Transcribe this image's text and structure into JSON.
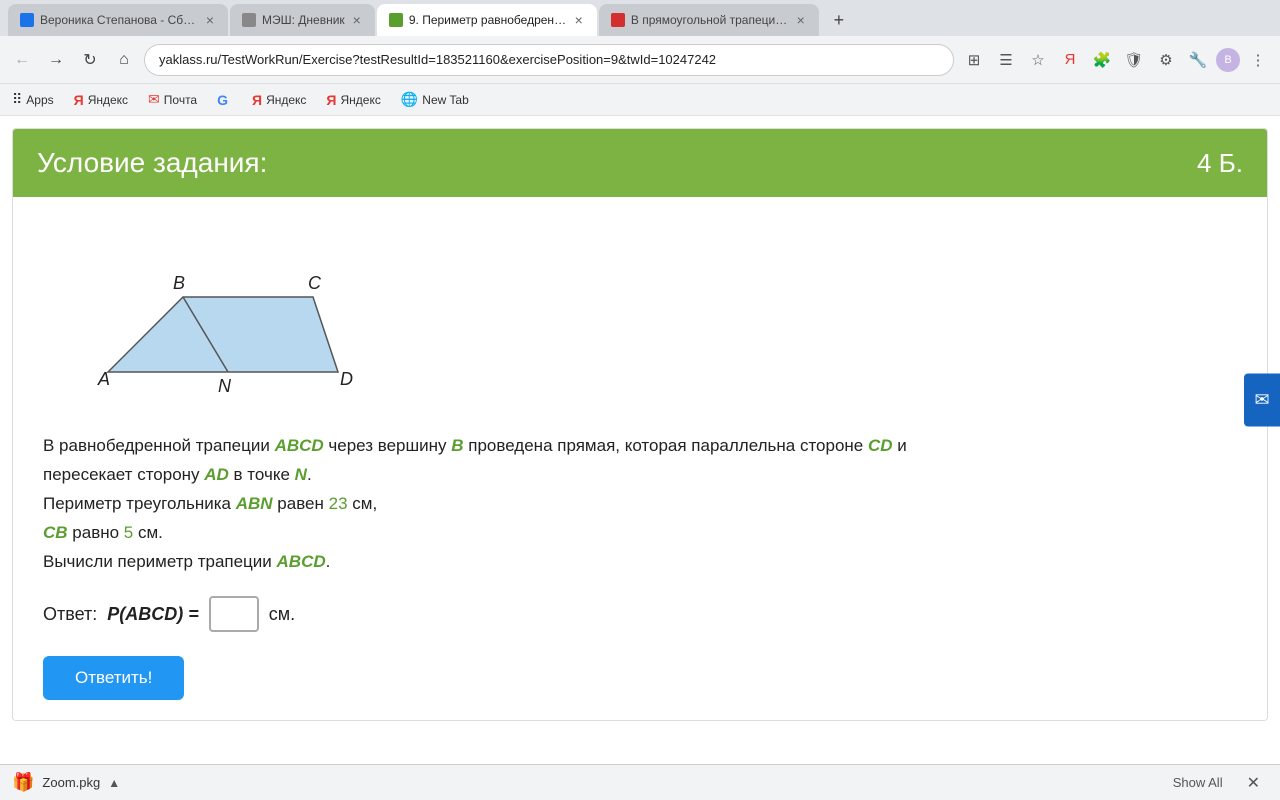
{
  "tabs": [
    {
      "id": "tab1",
      "label": "Вероника Степанова - Сборн...",
      "favicon_color": "#1a73e8",
      "active": false
    },
    {
      "id": "tab2",
      "label": "МЭШ: Дневник",
      "favicon_color": "#888",
      "active": false
    },
    {
      "id": "tab3",
      "label": "9. Периметр равнобедренно...",
      "favicon_color": "#5a9e2f",
      "active": true
    },
    {
      "id": "tab4",
      "label": "В прямоугольной трапеции о...",
      "favicon_color": "#d32f2f",
      "active": false
    }
  ],
  "address_bar": {
    "url": "yaklass.ru/TestWorkRun/Exercise?testResultId=183521160&exercisePosition=9&twId=10247242"
  },
  "bookmarks": [
    {
      "label": "Apps"
    },
    {
      "label": "Яндекс"
    },
    {
      "label": "Почта"
    },
    {
      "label": "G"
    },
    {
      "label": "Яндекс"
    },
    {
      "label": "Яндекс"
    },
    {
      "label": "New Tab"
    }
  ],
  "card": {
    "header_title": "Условие задания:",
    "header_points": "4 Б.",
    "problem_lines": {
      "line1_pre": "В равнобедренной трапеции ",
      "line1_abcd": "ABCD",
      "line1_mid": " через вершину ",
      "line1_b": "B",
      "line1_post": " проведена прямая, которая параллельна стороне ",
      "line1_cd": "CD",
      "line1_end": " и",
      "line2_pre": "пересекает сторону ",
      "line2_ad": "AD",
      "line2_mid": " в точке ",
      "line2_n": "N",
      "line2_end": ".",
      "line3_pre": "Периметр треугольника ",
      "line3_abn": "ABN",
      "line3_mid": " равен ",
      "line3_23": "23",
      "line3_end": " см,",
      "line4_pre": "",
      "line4_cb": "CB",
      "line4_mid": " равно ",
      "line4_5": "5",
      "line4_end": " см.",
      "line5": "Вычисли периметр трапеции ",
      "line5_abcd": "ABCD",
      "line5_end": "."
    },
    "answer_label": "Ответ:",
    "answer_formula": "P(ABCD) =",
    "answer_unit": "см.",
    "answer_value": "",
    "submit_label": "Ответить!"
  },
  "download": {
    "filename": "Zoom.pkg",
    "show_all": "Show All"
  },
  "feedback_icon": "✉"
}
